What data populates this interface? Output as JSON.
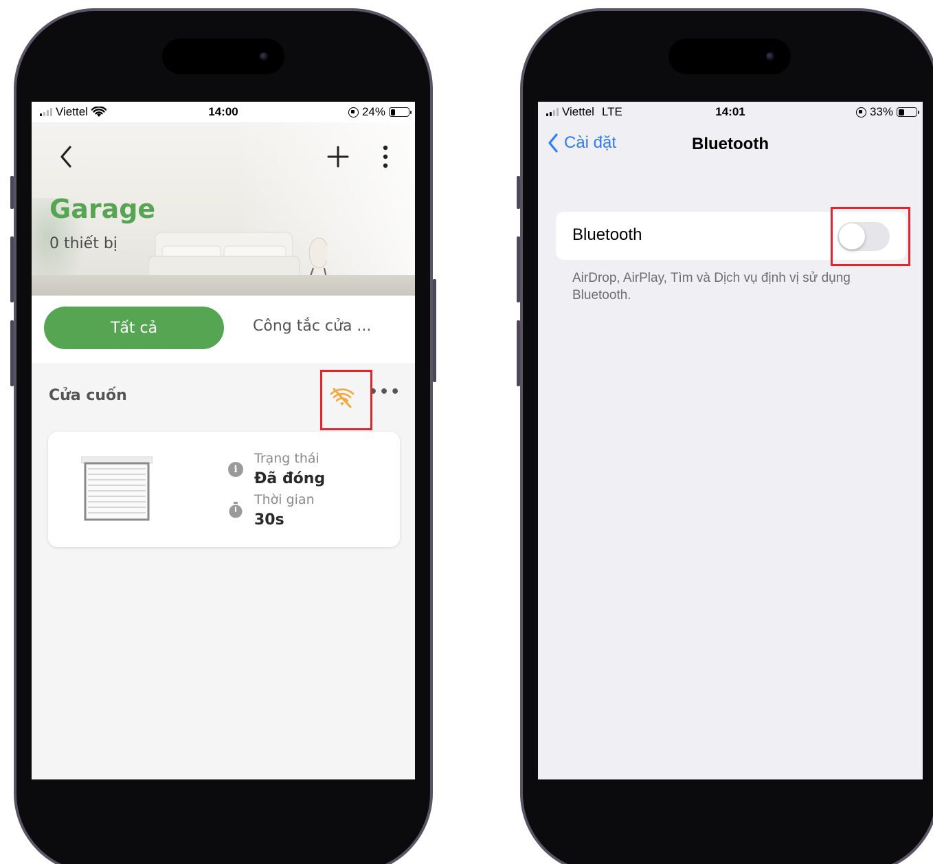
{
  "left_phone": {
    "status": {
      "carrier": "Viettel",
      "time": "14:00",
      "battery": "24%",
      "battery_level": 0.24
    },
    "header": {
      "room_name": "Garage",
      "device_count": "0 thiết bị"
    },
    "tabs": [
      {
        "label": "Tất cả",
        "active": true
      },
      {
        "label": "Công tắc cửa ...",
        "active": false
      }
    ],
    "group": {
      "title": "Cửa cuốn",
      "more": "•••"
    },
    "device_card": {
      "status_label": "Trạng thái",
      "status_value": "Đã đóng",
      "time_label": "Thời gian",
      "time_value": "30s"
    },
    "colors": {
      "brand_green": "#56a552",
      "warning_orange": "#f0a93b",
      "highlight_red": "#e8222a"
    }
  },
  "right_phone": {
    "status": {
      "carrier": "Viettel",
      "network": "LTE",
      "time": "14:01",
      "battery": "33%",
      "battery_level": 0.33
    },
    "nav": {
      "back_label": "Cài đặt",
      "title": "Bluetooth"
    },
    "bluetooth": {
      "label": "Bluetooth",
      "enabled": false
    },
    "footnote": "AirDrop, AirPlay, Tìm và Dịch vụ định vị sử dụng Bluetooth.",
    "colors": {
      "ios_blue": "#2f7cf6",
      "highlight_red": "#e8222a"
    }
  }
}
